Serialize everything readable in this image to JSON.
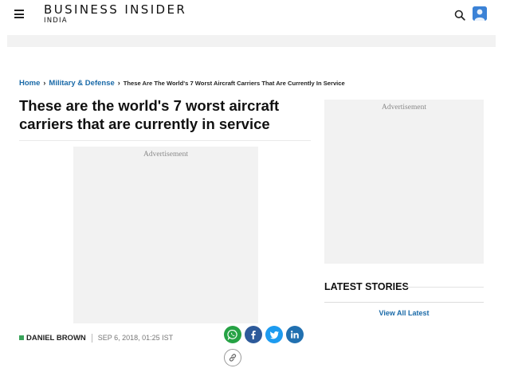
{
  "header": {
    "logo_main": "BUSINESS INSIDER",
    "logo_sub": "INDIA",
    "menu_icon": "hamburger-menu-icon",
    "search_icon": "search-icon",
    "avatar_icon": "user-avatar-icon"
  },
  "breadcrumb": {
    "home": "Home",
    "category": "Military & Defense",
    "separator": "›",
    "current": "These Are The World's 7 Worst Aircraft Carriers That Are Currently In Service"
  },
  "article": {
    "title": "These are the world's 7 worst aircraft carriers that are currently in service",
    "author": "DANIEL BROWN",
    "date": "SEP 6, 2018, 01:25 IST"
  },
  "ads": {
    "main_label": "Advertisement",
    "side_label": "Advertisement"
  },
  "sidebar": {
    "latest_title": "LATEST STORIES",
    "view_all": "View All Latest"
  },
  "share": {
    "icons": [
      "whatsapp-icon",
      "facebook-icon",
      "twitter-icon",
      "linkedin-icon",
      "copy-link-icon"
    ]
  },
  "colors": {
    "link_blue": "#1a6aa8",
    "author_green": "#3aa35b",
    "whatsapp": "#25a244",
    "facebook": "#2d5a9a",
    "twitter": "#1d9bf0",
    "linkedin": "#2170b0",
    "ad_bg": "#f2f2f2"
  }
}
